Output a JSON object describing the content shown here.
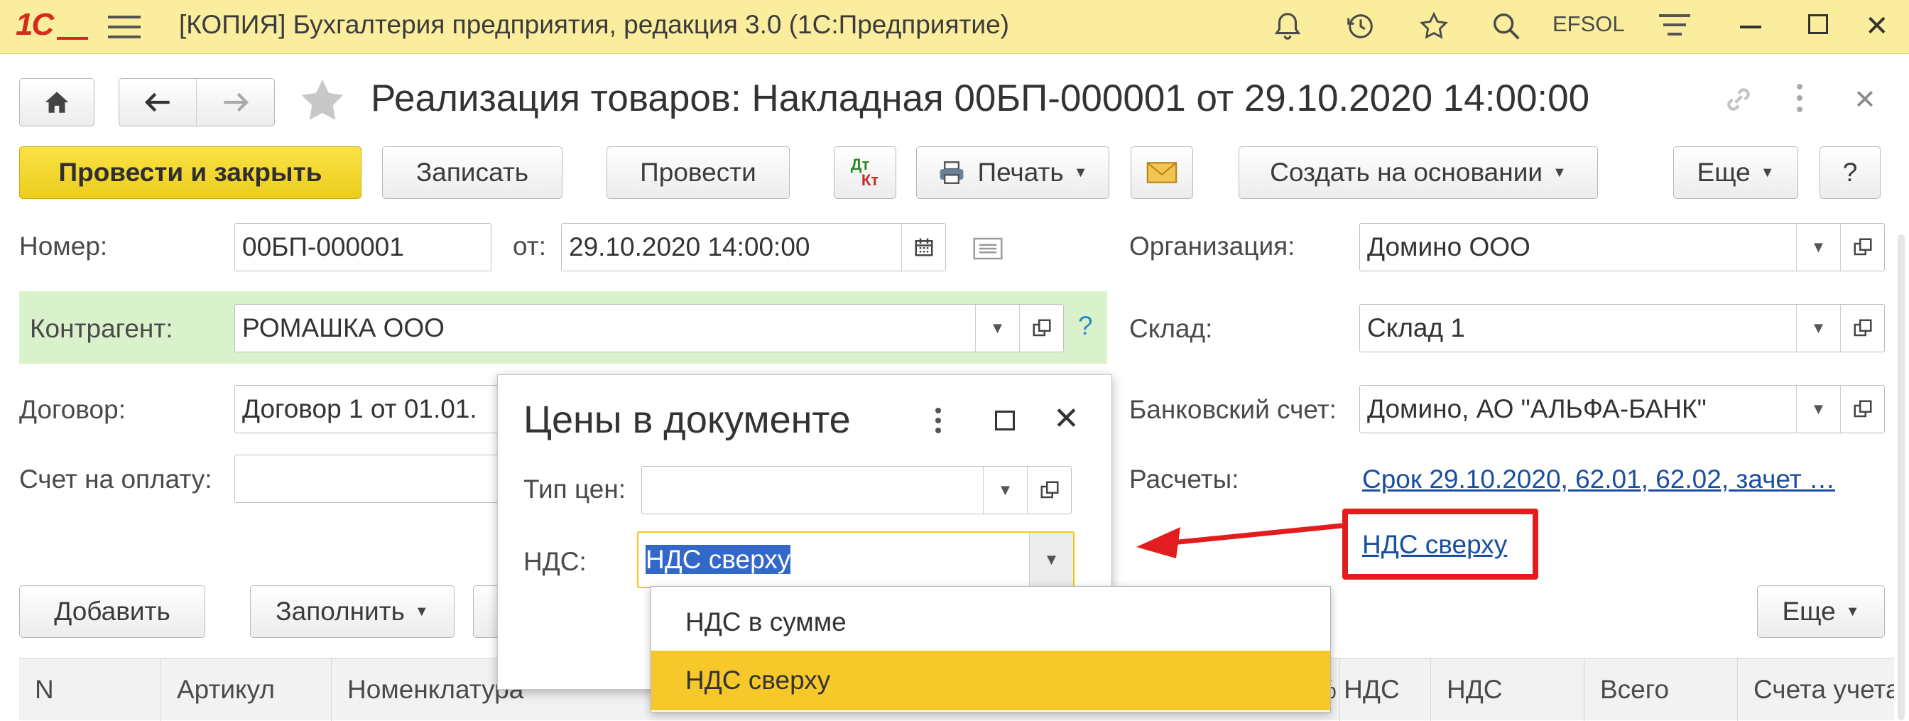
{
  "app": {
    "logo": "1С",
    "title": "[КОПИЯ] Бухгалтерия предприятия, редакция 3.0  (1С:Предприятие)",
    "user": "EFSOL",
    "accent": "#fbed9e"
  },
  "doc": {
    "title": "Реализация товаров: Накладная 00БП-000001 от 29.10.2020 14:00:00"
  },
  "toolbar": {
    "post_close": "Провести и закрыть",
    "save": "Записать",
    "post": "Провести",
    "dtkt_top": "Дт",
    "dtkt_bottom": "Кт",
    "print": "Печать",
    "create_based": "Создать на основании",
    "more": "Еще",
    "help": "?"
  },
  "form": {
    "number_label": "Номер:",
    "number_value": "00БП-000001",
    "date_label": "от:",
    "date_value": "29.10.2020 14:00:00",
    "counterparty_label": "Контрагент:",
    "counterparty_value": "РОМАШКА ООО",
    "help_mark": "?",
    "contract_label": "Договор:",
    "contract_value": "Договор 1 от 01.01.",
    "invoice_label": "Счет на оплату:",
    "invoice_value": "",
    "org_label": "Организация:",
    "org_value": "Домино ООО",
    "warehouse_label": "Склад:",
    "warehouse_value": "Склад 1",
    "bank_label": "Банковский счет:",
    "bank_value": "Домино, АО \"АЛЬФА-БАНК\"",
    "settlements_label": "Расчеты:",
    "settlements_link": "Срок 29.10.2020, 62.01, 62.02, зачет …",
    "vat_link": "НДС сверху"
  },
  "dialog": {
    "title": "Цены в документе",
    "price_type_label": "Тип цен:",
    "price_type_value": "",
    "vat_label": "НДС:",
    "vat_value": "НДС сверху",
    "options": [
      "НДС в сумме",
      "НДС сверху"
    ],
    "selected_option": "НДС сверху"
  },
  "table_toolbar": {
    "add": "Добавить",
    "fill": "Заполнить",
    "more": "Еще"
  },
  "table": {
    "columns": [
      "N",
      "Артикул",
      "Номенклатура",
      "% НДС",
      "НДС",
      "Всего",
      "Счета учета"
    ]
  }
}
